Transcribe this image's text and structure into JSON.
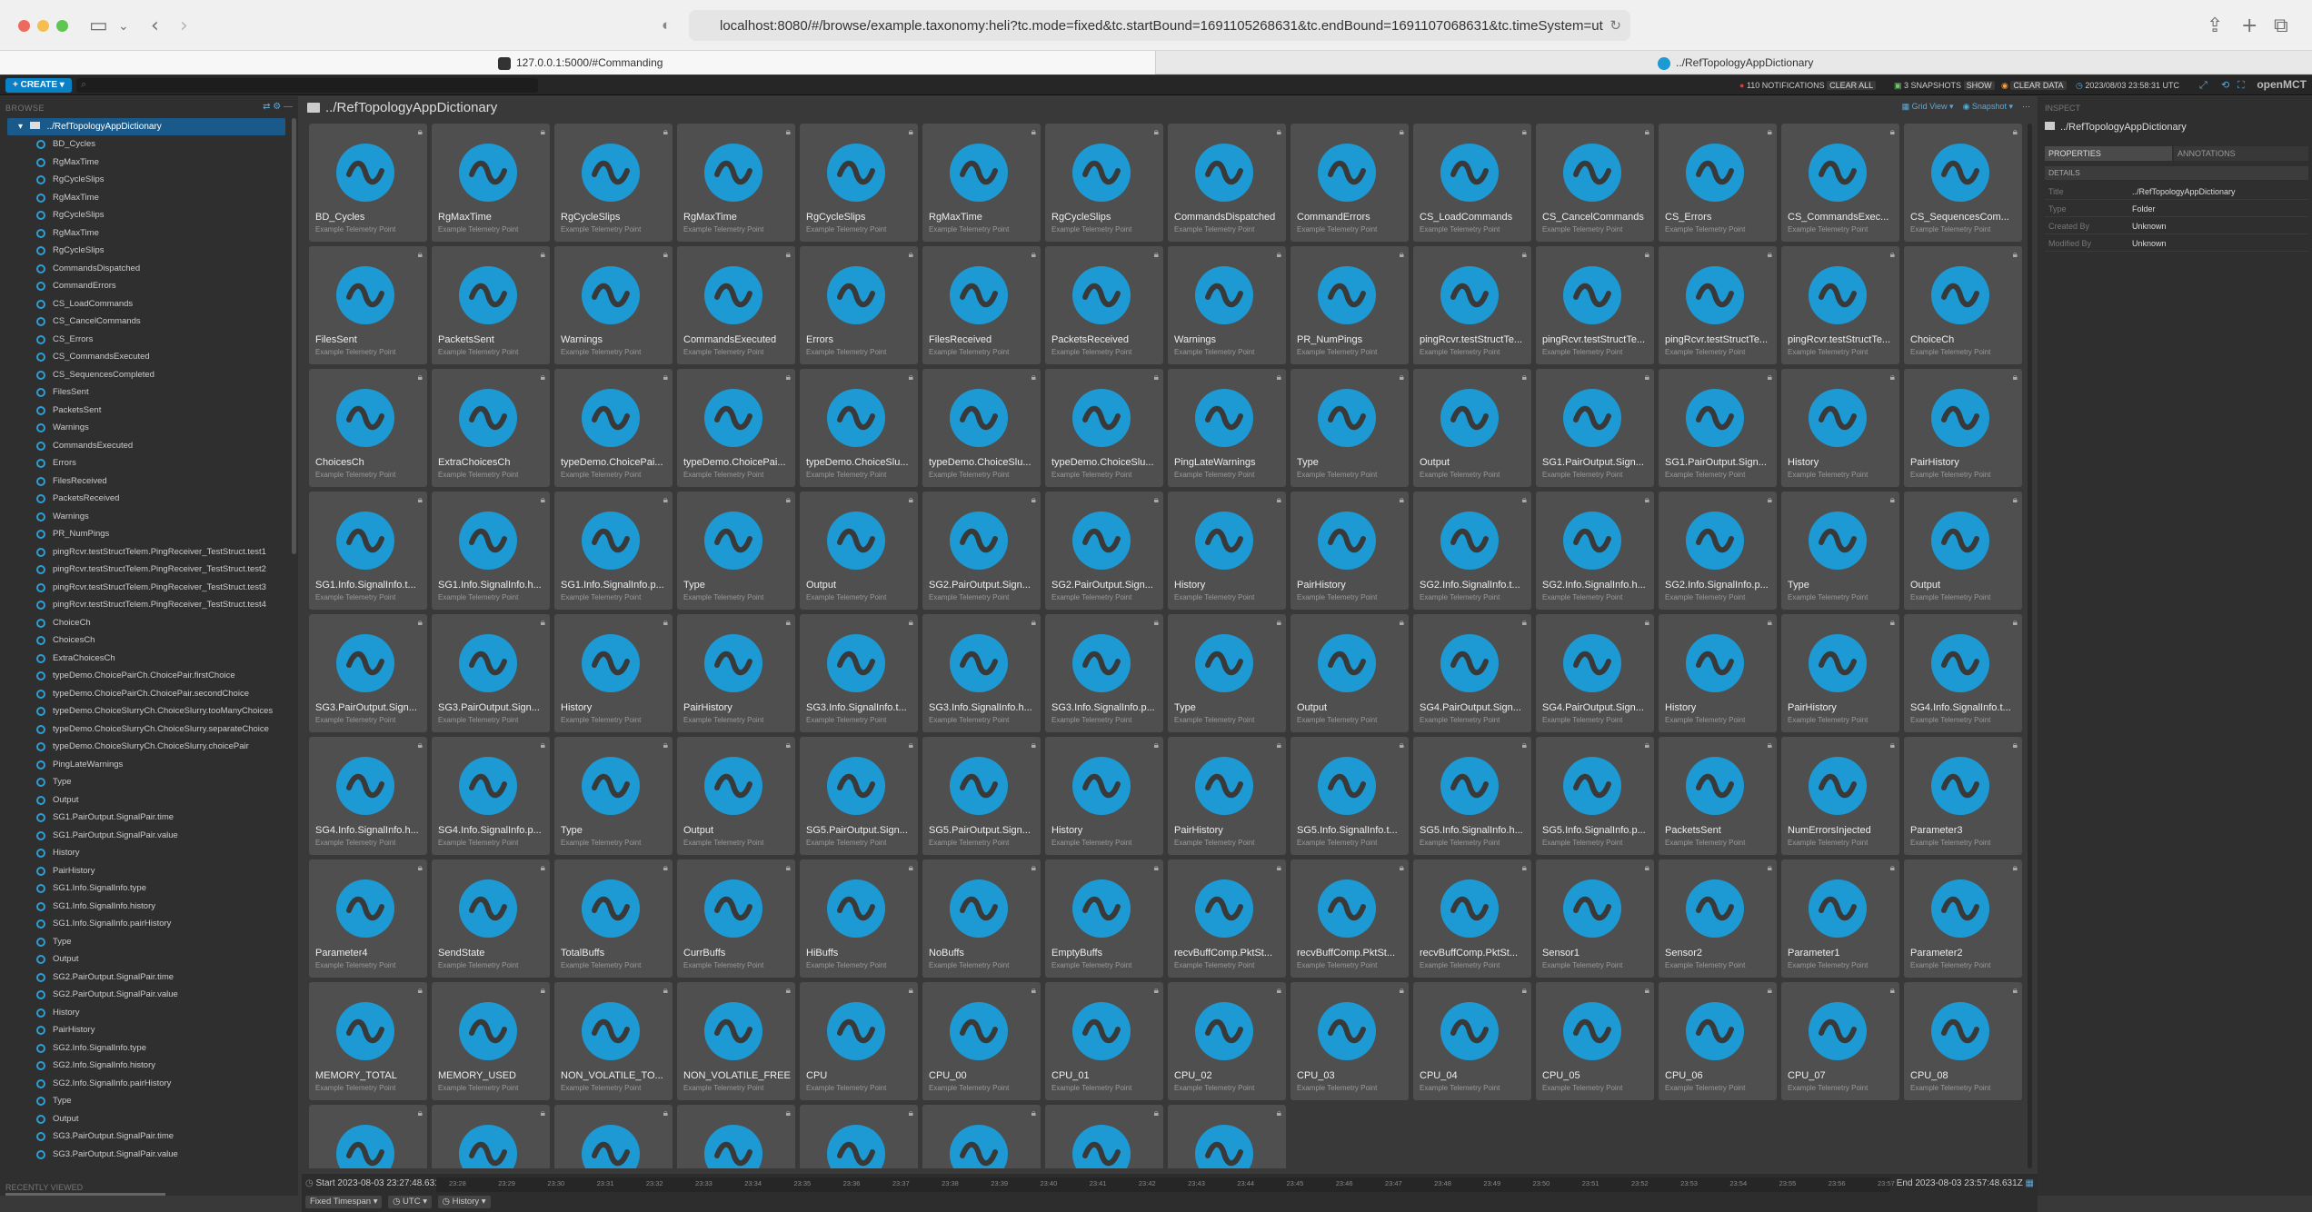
{
  "browser": {
    "url": "localhost:8080/#/browse/example.taxonomy:heli?tc.mode=fixed&tc.startBound=1691105268631&tc.endBound=1691107068631&tc.timeSystem=utc&view=grid",
    "tabs": [
      {
        "label": "127.0.0.1:5000/#Commanding"
      },
      {
        "label": "../RefTopologyAppDictionary"
      }
    ]
  },
  "appbar": {
    "create_label": "+ CREATE ▾",
    "search_placeholder": "",
    "notifications": "110 NOTIFICATIONS",
    "clear_all": "CLEAR ALL",
    "snapshots": "3 SNAPSHOTS",
    "show": "SHOW",
    "clear_data": "CLEAR DATA",
    "clock": "2023/08/03 23:58:31 UTC",
    "logo": "openMCT"
  },
  "sidebar": {
    "header": "BROWSE",
    "root": "../RefTopologyAppDictionary",
    "recent_label": "RECENTLY VIEWED",
    "items": [
      "BD_Cycles",
      "RgMaxTime",
      "RgCycleSlips",
      "RgMaxTime",
      "RgCycleSlips",
      "RgMaxTime",
      "RgCycleSlips",
      "CommandsDispatched",
      "CommandErrors",
      "CS_LoadCommands",
      "CS_CancelCommands",
      "CS_Errors",
      "CS_CommandsExecuted",
      "CS_SequencesCompleted",
      "FilesSent",
      "PacketsSent",
      "Warnings",
      "CommandsExecuted",
      "Errors",
      "FilesReceived",
      "PacketsReceived",
      "Warnings",
      "PR_NumPings",
      "pingRcvr.testStructTelem.PingReceiver_TestStruct.test1",
      "pingRcvr.testStructTelem.PingReceiver_TestStruct.test2",
      "pingRcvr.testStructTelem.PingReceiver_TestStruct.test3",
      "pingRcvr.testStructTelem.PingReceiver_TestStruct.test4",
      "ChoiceCh",
      "ChoicesCh",
      "ExtraChoicesCh",
      "typeDemo.ChoicePairCh.ChoicePair.firstChoice",
      "typeDemo.ChoicePairCh.ChoicePair.secondChoice",
      "typeDemo.ChoiceSlurryCh.ChoiceSlurry.tooManyChoices",
      "typeDemo.ChoiceSlurryCh.ChoiceSlurry.separateChoice",
      "typeDemo.ChoiceSlurryCh.ChoiceSlurry.choicePair",
      "PingLateWarnings",
      "Type",
      "Output",
      "SG1.PairOutput.SignalPair.time",
      "SG1.PairOutput.SignalPair.value",
      "History",
      "PairHistory",
      "SG1.Info.SignalInfo.type",
      "SG1.Info.SignalInfo.history",
      "SG1.Info.SignalInfo.pairHistory",
      "Type",
      "Output",
      "SG2.PairOutput.SignalPair.time",
      "SG2.PairOutput.SignalPair.value",
      "History",
      "PairHistory",
      "SG2.Info.SignalInfo.type",
      "SG2.Info.SignalInfo.history",
      "SG2.Info.SignalInfo.pairHistory",
      "Type",
      "Output",
      "SG3.PairOutput.SignalPair.time",
      "SG3.PairOutput.SignalPair.value"
    ]
  },
  "main": {
    "title": "../RefTopologyAppDictionary",
    "grid_view": "Grid View ▾",
    "snapshot": "Snapshot ▾",
    "tile_type": "Example Telemetry Point",
    "tiles": [
      "BD_Cycles",
      "RgMaxTime",
      "RgCycleSlips",
      "RgMaxTime",
      "RgCycleSlips",
      "RgMaxTime",
      "RgCycleSlips",
      "CommandsDispatched",
      "CommandErrors",
      "CS_LoadCommands",
      "CS_CancelCommands",
      "CS_Errors",
      "CS_CommandsExec...",
      "CS_SequencesCom...",
      "FilesSent",
      "PacketsSent",
      "Warnings",
      "CommandsExecuted",
      "Errors",
      "FilesReceived",
      "PacketsReceived",
      "Warnings",
      "PR_NumPings",
      "pingRcvr.testStructTe...",
      "pingRcvr.testStructTe...",
      "pingRcvr.testStructTe...",
      "pingRcvr.testStructTe...",
      "ChoiceCh",
      "ChoicesCh",
      "ExtraChoicesCh",
      "typeDemo.ChoicePai...",
      "typeDemo.ChoicePai...",
      "typeDemo.ChoiceSlu...",
      "typeDemo.ChoiceSlu...",
      "typeDemo.ChoiceSlu...",
      "PingLateWarnings",
      "Type",
      "Output",
      "SG1.PairOutput.Sign...",
      "SG1.PairOutput.Sign...",
      "History",
      "PairHistory",
      "SG1.Info.SignalInfo.t...",
      "SG1.Info.SignalInfo.h...",
      "SG1.Info.SignalInfo.p...",
      "Type",
      "Output",
      "SG2.PairOutput.Sign...",
      "SG2.PairOutput.Sign...",
      "History",
      "PairHistory",
      "SG2.Info.SignalInfo.t...",
      "SG2.Info.SignalInfo.h...",
      "SG2.Info.SignalInfo.p...",
      "Type",
      "Output",
      "SG3.PairOutput.Sign...",
      "SG3.PairOutput.Sign...",
      "History",
      "PairHistory",
      "SG3.Info.SignalInfo.t...",
      "SG3.Info.SignalInfo.h...",
      "SG3.Info.SignalInfo.p...",
      "Type",
      "Output",
      "SG4.PairOutput.Sign...",
      "SG4.PairOutput.Sign...",
      "History",
      "PairHistory",
      "SG4.Info.SignalInfo.t...",
      "SG4.Info.SignalInfo.h...",
      "SG4.Info.SignalInfo.p...",
      "Type",
      "Output",
      "SG5.PairOutput.Sign...",
      "SG5.PairOutput.Sign...",
      "History",
      "PairHistory",
      "SG5.Info.SignalInfo.t...",
      "SG5.Info.SignalInfo.h...",
      "SG5.Info.SignalInfo.p...",
      "PacketsSent",
      "NumErrorsInjected",
      "Parameter3",
      "Parameter4",
      "SendState",
      "TotalBuffs",
      "CurrBuffs",
      "HiBuffs",
      "NoBuffs",
      "EmptyBuffs",
      "recvBuffComp.PktSt...",
      "recvBuffComp.PktSt...",
      "recvBuffComp.PktSt...",
      "Sensor1",
      "Sensor2",
      "Parameter1",
      "Parameter2",
      "MEMORY_TOTAL",
      "MEMORY_USED",
      "NON_VOLATILE_TO...",
      "NON_VOLATILE_FREE",
      "CPU",
      "CPU_00",
      "CPU_01",
      "CPU_02",
      "CPU_03",
      "CPU_04",
      "CPU_05",
      "CPU_06",
      "CPU_07",
      "CPU_08",
      "",
      "",
      "",
      "",
      "",
      "",
      "",
      ""
    ]
  },
  "inspector": {
    "header": "INSPECT",
    "title": "../RefTopologyAppDictionary",
    "tab_properties": "PROPERTIES",
    "tab_annotations": "ANNOTATIONS",
    "section": "DETAILS",
    "rows": [
      {
        "k": "Title",
        "v": "../RefTopologyAppDictionary"
      },
      {
        "k": "Type",
        "v": "Folder"
      },
      {
        "k": "Created By",
        "v": "Unknown"
      },
      {
        "k": "Modified By",
        "v": "Unknown"
      }
    ]
  },
  "timeline": {
    "start_label": "Start",
    "start": "2023-08-03 23:27:48.631Z",
    "end_label": "End",
    "end": "2023-08-03 23:57:48.631Z",
    "ticks": [
      "23:28",
      "23:29",
      "23:30",
      "23:31",
      "23:32",
      "23:33",
      "23:34",
      "23:35",
      "23:36",
      "23:37",
      "23:38",
      "23:39",
      "23:40",
      "23:41",
      "23:42",
      "23:43",
      "23:44",
      "23:45",
      "23:46",
      "23:47",
      "23:48",
      "23:49",
      "23:50",
      "23:51",
      "23:52",
      "23:53",
      "23:54",
      "23:55",
      "23:56",
      "23:57"
    ],
    "mode": "Fixed Timespan ▾",
    "timesys": "UTC ▾",
    "history": "History ▾"
  },
  "colors": {
    "accent": "#1d9ad3",
    "tile_bg": "#4f4f4f"
  }
}
